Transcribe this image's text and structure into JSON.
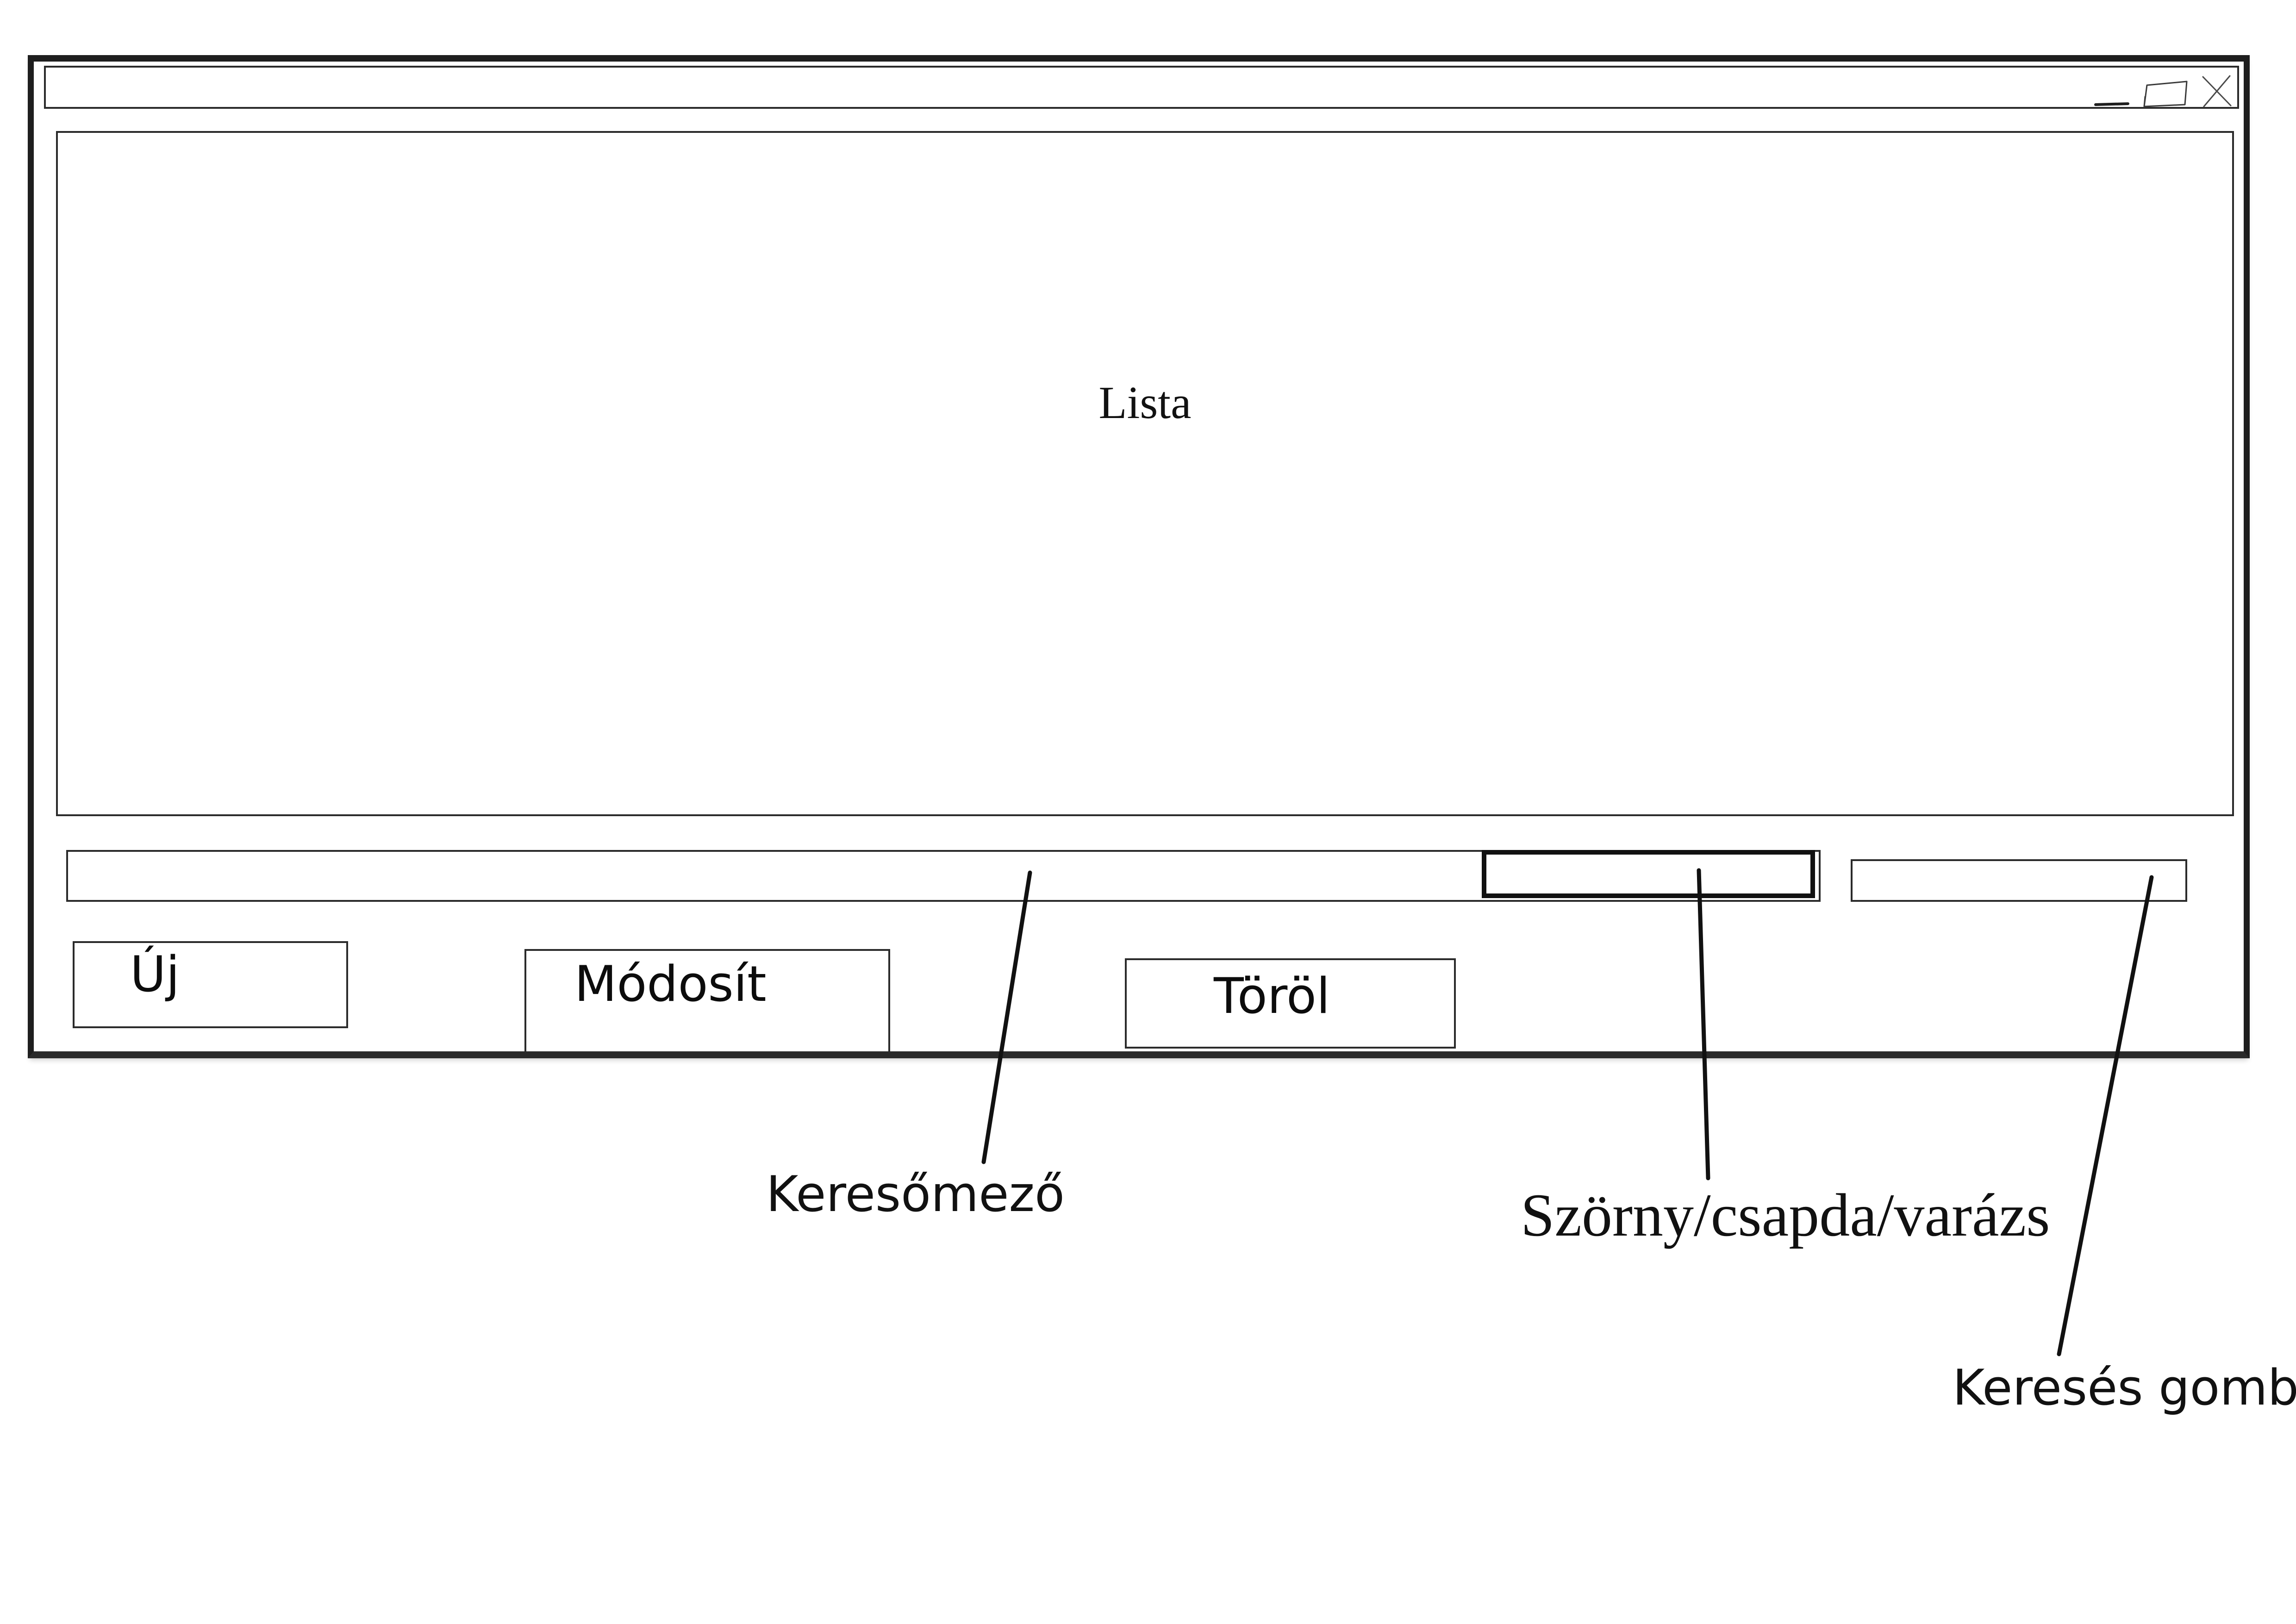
{
  "list": {
    "label": "Lista"
  },
  "buttons": {
    "new_label": "Új",
    "modify_label": "Módosít",
    "delete_label": "Töröl"
  },
  "search": {
    "field_value": "",
    "type_value": "",
    "button_label": ""
  },
  "annotations": {
    "search_field": "Keresőmező",
    "type_select": "Szörny/csapda/varázs",
    "search_button": "Keresés gomb"
  },
  "window_controls": {
    "minimize_icon": "minimize-icon",
    "maximize_icon": "maximize-icon",
    "close_icon": "close-icon"
  },
  "colors": {
    "stroke": "#1e1e1e",
    "background": "#ffffff"
  }
}
